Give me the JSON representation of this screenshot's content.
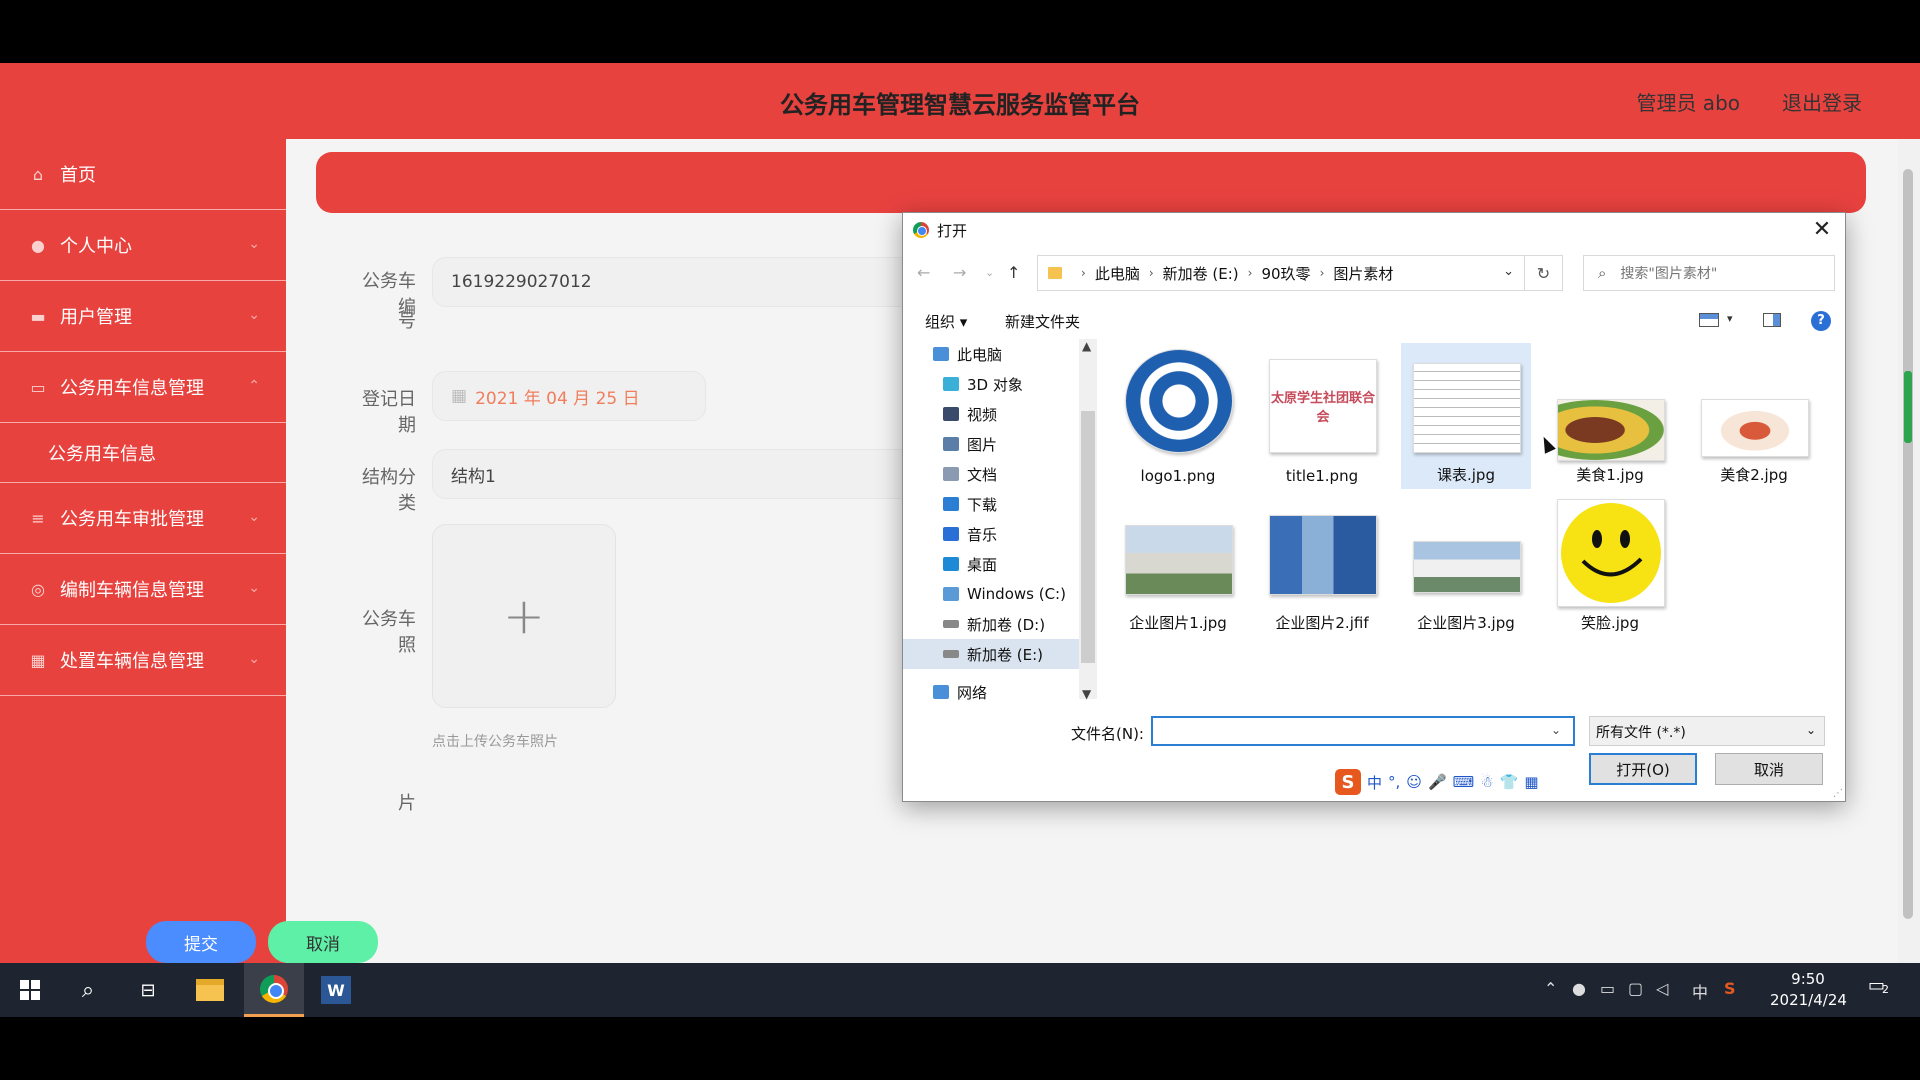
{
  "header": {
    "title": "公务用车管理智慧云服务监管平台",
    "user": "管理员 abo",
    "logout": "退出登录"
  },
  "sidebar": {
    "items": [
      {
        "label": "首页",
        "icon": "home-icon"
      },
      {
        "label": "个人中心",
        "icon": "user-icon"
      },
      {
        "label": "用户管理",
        "icon": "folder-icon"
      },
      {
        "label": "公务用车信息管理",
        "icon": "car-info-icon"
      },
      {
        "label": "公务用车信息",
        "icon": ""
      },
      {
        "label": "公务用车审批管理",
        "icon": "list-icon"
      },
      {
        "label": "编制车辆信息管理",
        "icon": "compass-icon"
      },
      {
        "label": "处置车辆信息管理",
        "icon": "grid-icon"
      }
    ]
  },
  "form": {
    "car_no_label_1": "公务车编",
    "car_no_label_2": "号",
    "car_no_value": "1619229027012",
    "date_label": "登记日期",
    "date_value": "2021 年 04 月 25 日",
    "category_label": "结构分类",
    "category_value": "结构1",
    "photo_label_1": "公务车照",
    "photo_label_2": "片",
    "upload_plus": "+",
    "upload_hint": "点击上传公务车照片",
    "submit": "提交",
    "cancel": "取消"
  },
  "dialog": {
    "title": "打开",
    "close": "✕",
    "path": [
      "此电脑",
      "新加卷 (E:)",
      "90玖零",
      "图片素材"
    ],
    "search_placeholder": "搜索\"图片素材\"",
    "organize": "组织 ▾",
    "new_folder": "新建文件夹",
    "help": "?",
    "tree": [
      {
        "label": "此电脑",
        "color": "#4a90d9"
      },
      {
        "label": "3D 对象",
        "color": "#3ab0d8"
      },
      {
        "label": "视频",
        "color": "#3a4a6a"
      },
      {
        "label": "图片",
        "color": "#5a7ea8"
      },
      {
        "label": "文档",
        "color": "#8a9ab0"
      },
      {
        "label": "下载",
        "color": "#2a7fd4"
      },
      {
        "label": "音乐",
        "color": "#2a6fd6"
      },
      {
        "label": "桌面",
        "color": "#1e8ad6"
      },
      {
        "label": "Windows (C:)",
        "color": "#5a9ad6"
      },
      {
        "label": "新加卷 (D:)",
        "color": "#888888"
      },
      {
        "label": "新加卷 (E:)",
        "color": "#888888"
      },
      {
        "label": "网络",
        "color": "#4a90d9"
      }
    ],
    "files": [
      {
        "name": "logo1.png"
      },
      {
        "name": "title1.png"
      },
      {
        "name": "课表.jpg"
      },
      {
        "name": "美食1.jpg"
      },
      {
        "name": "美食2.jpg"
      },
      {
        "name": "企业图片1.jpg"
      },
      {
        "name": "企业图片2.jfif"
      },
      {
        "name": "企业图片3.jpg"
      },
      {
        "name": "笑脸.jpg"
      }
    ],
    "title_image_text": "太原学生社团联合会",
    "filename_label": "文件名(N):",
    "filename_value": "",
    "filetype": "所有文件 (*.*)",
    "open_button": "打开(O)",
    "cancel_button": "取消",
    "ime": {
      "logo": "S",
      "items": [
        "中",
        "°,",
        "☺",
        "🎤",
        "⌨",
        "☃",
        "👕",
        "▦"
      ]
    }
  },
  "taskbar": {
    "time": "9:50",
    "date": "2021/4/24",
    "notifications": "2",
    "ime_lang": "中"
  }
}
